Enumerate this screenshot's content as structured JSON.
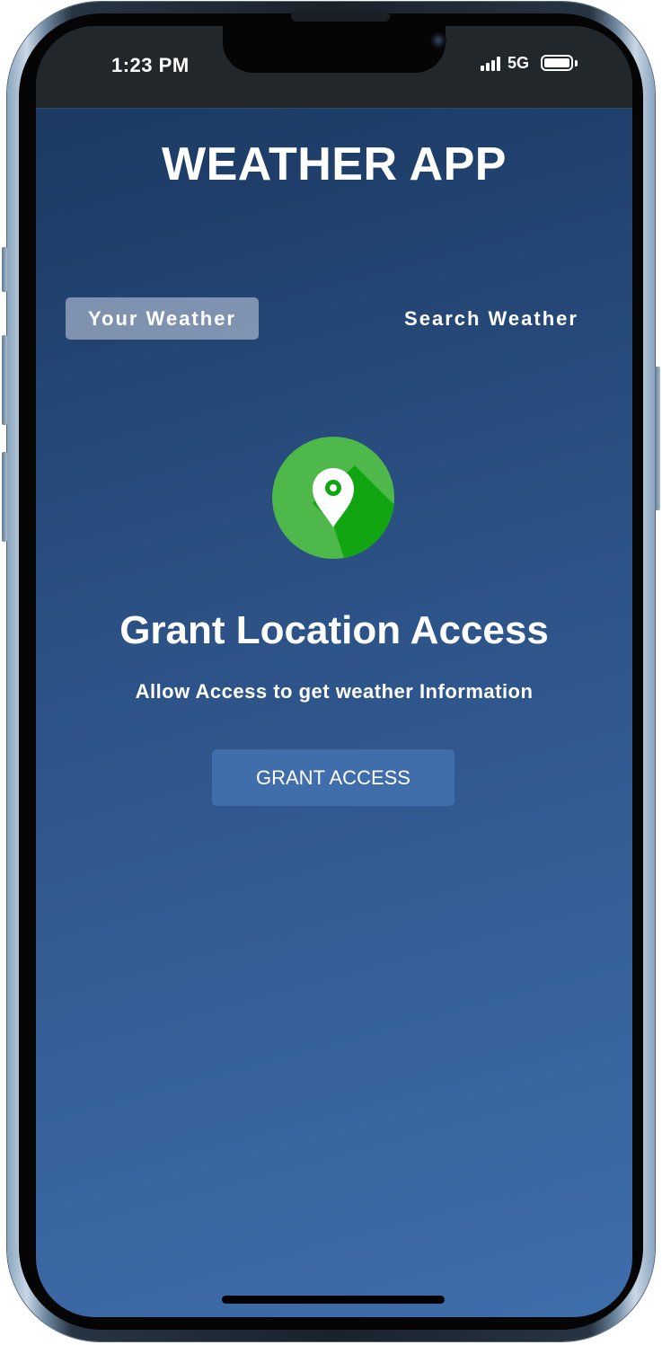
{
  "status_bar": {
    "time": "1:23 PM",
    "network": "5G"
  },
  "app": {
    "title": "WEATHER APP",
    "tabs": [
      {
        "label": "Your Weather",
        "active": true
      },
      {
        "label": "Search Weather",
        "active": false
      }
    ],
    "location_icon": "location-pin-icon",
    "headline": "Grant Location Access",
    "subline": "Allow Access to get weather Information",
    "grant_button_label": "GRANT ACCESS"
  },
  "colors": {
    "background_top": "#19365d",
    "background_bottom": "#3f6eac",
    "button": "#3f6eab",
    "icon_circle": "#4fb84a",
    "icon_shadow": "#12a512"
  }
}
